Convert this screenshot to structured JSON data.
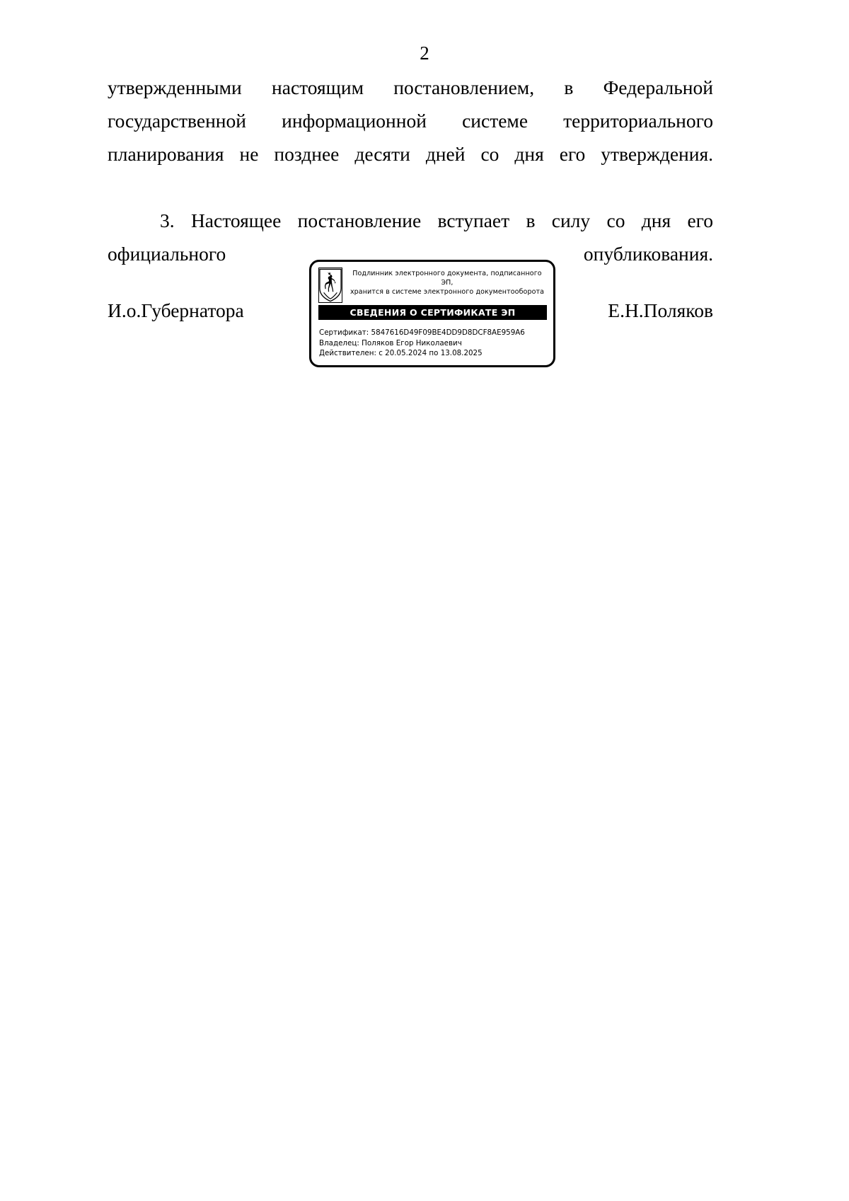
{
  "page": {
    "number": "2"
  },
  "body": {
    "paragraph_continued": "утвержденными настоящим постановлением, в Федеральной государственной информационной системе территориального планирования не позднее десяти дней со дня его утверждения.",
    "paragraph_3": "3. Настоящее постановление вступает в силу со дня его официального опубликования."
  },
  "signature": {
    "title": "И.о.Губернатора",
    "name": "Е.Н.Поляков"
  },
  "stamp": {
    "header_line1": "Подлинник электронного документа, подписанного ЭП,",
    "header_line2": "хранится в системе электронного документооборота",
    "banner": "СВЕДЕНИЯ О СЕРТИФИКАТЕ ЭП",
    "certificate_label": "Сертификат:",
    "certificate_value": "5847616D49F09BE4DD9D8DCF8AE959A6",
    "owner_label": "Владелец:",
    "owner_value": "Поляков Егор Николаевич",
    "valid_label": "Действителен:",
    "valid_value": "с 20.05.2024 по 13.08.2025",
    "emblem_name": "coat-of-arms-deer-icon"
  }
}
